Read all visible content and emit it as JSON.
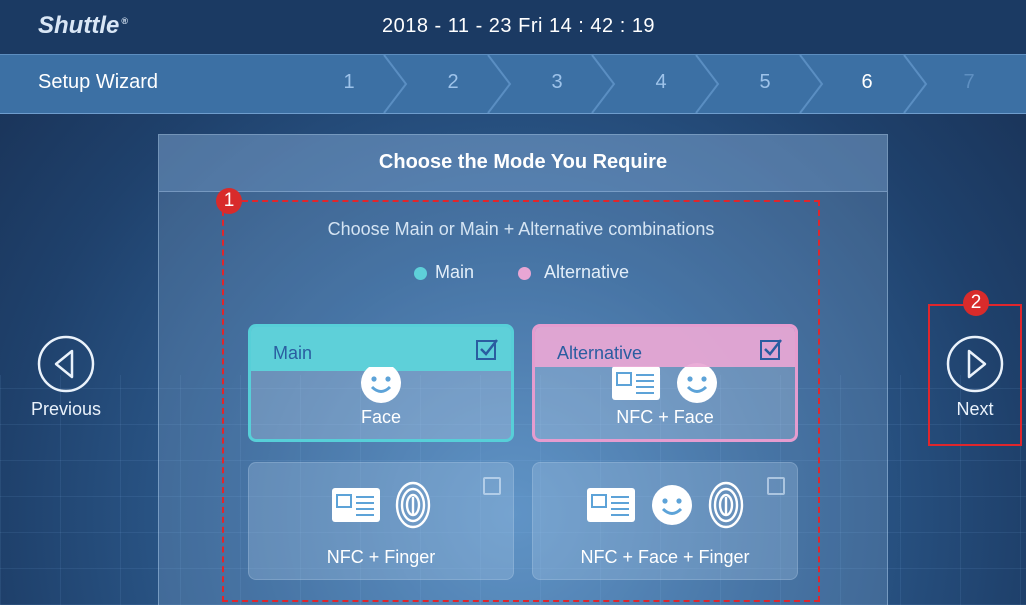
{
  "header": {
    "logo": "Shuttle",
    "logo_mark": "®",
    "datetime": "2018 - 11 - 23  Fri  14 : 42 : 19"
  },
  "wizard": {
    "title": "Setup Wizard",
    "steps": [
      "1",
      "2",
      "3",
      "4",
      "5",
      "6",
      "7"
    ],
    "current_step": "6"
  },
  "panel": {
    "title": "Choose the Mode You Require",
    "subtitle": "Choose Main or Main + Alternative combinations",
    "legend": {
      "main_label": "Main",
      "main_color": "#5ed0d9",
      "alternative_label": "Alternative",
      "alternative_color": "#e8a6d4"
    },
    "cards": [
      {
        "label": "Face",
        "tag": "Main",
        "selected": true,
        "icons": [
          "face-icon"
        ]
      },
      {
        "label": "NFC + Face",
        "tag": "Alternative",
        "selected": true,
        "icons": [
          "nfc-card-icon",
          "face-icon"
        ]
      },
      {
        "label": "NFC + Finger",
        "tag": "",
        "selected": false,
        "icons": [
          "nfc-card-icon",
          "fingerprint-icon"
        ]
      },
      {
        "label": "NFC + Face + Finger",
        "tag": "",
        "selected": false,
        "icons": [
          "nfc-card-icon",
          "face-icon",
          "fingerprint-icon"
        ]
      }
    ]
  },
  "nav": {
    "previous_label": "Previous",
    "next_label": "Next"
  },
  "callouts": [
    "1",
    "2"
  ]
}
